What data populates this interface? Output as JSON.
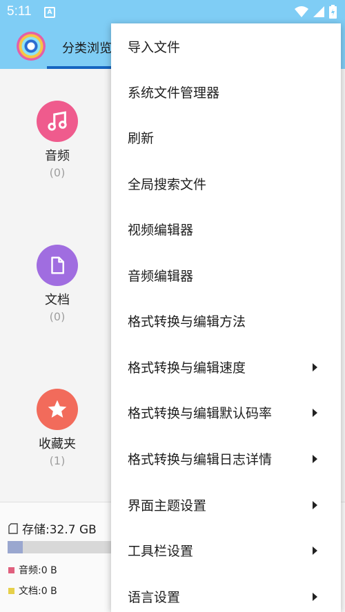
{
  "status_bar": {
    "time": "5:11",
    "notification_glyph": "A"
  },
  "app_bar": {
    "active_tab": "分类浏览"
  },
  "categories": [
    {
      "name": "音频",
      "count": "(0)",
      "icon": "music-note-icon",
      "color": "#ef5b8d"
    },
    {
      "name": "文档",
      "count": "(0)",
      "icon": "document-icon",
      "color": "#a06de0"
    },
    {
      "name": "收藏夹",
      "count": "(1)",
      "icon": "star-icon",
      "color": "#f26b5b"
    }
  ],
  "storage": {
    "title": "存储:32.7 GB",
    "used_fraction": 0.045,
    "legend": [
      {
        "label": "音频:0 B",
        "color": "#e0607e"
      },
      {
        "label": "文档:0 B",
        "color": "#e6d04a"
      }
    ]
  },
  "menu": {
    "items": [
      {
        "label": "导入文件",
        "submenu": false
      },
      {
        "label": "系统文件管理器",
        "submenu": false
      },
      {
        "label": "刷新",
        "submenu": false
      },
      {
        "label": "全局搜索文件",
        "submenu": false
      },
      {
        "label": "视频编辑器",
        "submenu": false
      },
      {
        "label": "音频编辑器",
        "submenu": false
      },
      {
        "label": "格式转换与编辑方法",
        "submenu": false
      },
      {
        "label": "格式转换与编辑速度",
        "submenu": true
      },
      {
        "label": "格式转换与编辑默认码率",
        "submenu": true
      },
      {
        "label": "格式转换与编辑日志详情",
        "submenu": true
      },
      {
        "label": "界面主题设置",
        "submenu": true
      },
      {
        "label": "工具栏设置",
        "submenu": true
      },
      {
        "label": "语言设置",
        "submenu": true
      }
    ]
  },
  "colors": {
    "accent": "#7fcdf5",
    "tab_indicator": "#1565c0"
  }
}
